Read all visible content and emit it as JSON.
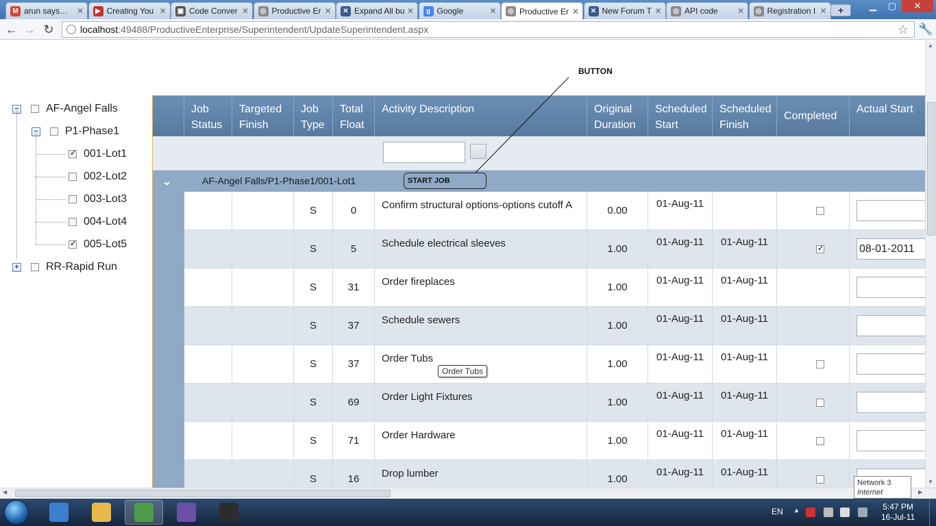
{
  "browser": {
    "tabs": [
      {
        "label": "arun says…",
        "favicon": "gmail-icon",
        "color": "#d14836",
        "glyph": "M"
      },
      {
        "label": "Creating You",
        "favicon": "youtube-icon",
        "color": "#c4302b",
        "glyph": "▶"
      },
      {
        "label": "Code Conver",
        "favicon": "page-icon",
        "color": "#555555",
        "glyph": "▣"
      },
      {
        "label": "Productive Er",
        "favicon": "globe-icon",
        "color": "#8a8a8a",
        "glyph": "◎"
      },
      {
        "label": "Expand All bu",
        "favicon": "forum-icon",
        "color": "#3a5a8c",
        "glyph": "✕"
      },
      {
        "label": "Google",
        "favicon": "google-icon",
        "color": "#4285f4",
        "glyph": "g"
      },
      {
        "label": "Productive Er",
        "favicon": "globe-icon",
        "color": "#8a8a8a",
        "glyph": "◎",
        "active": true
      },
      {
        "label": "New Forum T",
        "favicon": "forum-icon",
        "color": "#3a5a8c",
        "glyph": "✕"
      },
      {
        "label": "API code",
        "favicon": "globe-icon",
        "color": "#8a8a8a",
        "glyph": "◎"
      },
      {
        "label": "Registration I",
        "favicon": "globe-icon",
        "color": "#8a8a8a",
        "glyph": "◎"
      }
    ],
    "url_host": "localhost",
    "url_rest": ":49488/ProductiveEnterprise/Superintendent/UpdateSuperintendent.aspx"
  },
  "page": {
    "corner_text": "S",
    "tree": {
      "nodes": [
        {
          "label": "AF-Angel Falls",
          "checked": false,
          "expander": "−"
        },
        {
          "label": "P1-Phase1",
          "checked": false,
          "expander": "−"
        },
        {
          "label": "001-Lot1",
          "checked": true
        },
        {
          "label": "002-Lot2",
          "checked": false
        },
        {
          "label": "003-Lot3",
          "checked": false
        },
        {
          "label": "004-Lot4",
          "checked": false
        },
        {
          "label": "005-Lot5",
          "checked": true
        },
        {
          "label": "RR-Rapid Run",
          "checked": false,
          "expander": "+"
        }
      ]
    },
    "grid": {
      "headers": [
        {
          "label": "",
          "w": 46
        },
        {
          "label": "Job Status",
          "w": 70
        },
        {
          "label": "Targeted Finish",
          "w": 90
        },
        {
          "label": "Job Type",
          "w": 57
        },
        {
          "label": "Total Float",
          "w": 61
        },
        {
          "label": "Activity Description",
          "w": 310
        },
        {
          "label": "Original Duration",
          "w": 89
        },
        {
          "label": "Scheduled Start",
          "w": 94
        },
        {
          "label": "Scheduled Finish",
          "w": 94
        },
        {
          "label": "Completed",
          "w": 106
        },
        {
          "label": "Actual Start",
          "w": 113
        }
      ],
      "group_label": "AF-Angel Falls/P1-Phase1/001-Lot1",
      "start_job_label": "START JOB",
      "rows": [
        {
          "job_type": "S",
          "total_float": "0",
          "desc": "Confirm structural options-options cutoff A",
          "duration": "0.00",
          "sched_start": "01-Aug-11",
          "sched_finish": "",
          "completed": false,
          "show_cb": true,
          "actual_start": ""
        },
        {
          "job_type": "S",
          "total_float": "5",
          "desc": "Schedule electrical sleeves",
          "duration": "1.00",
          "sched_start": "01-Aug-11",
          "sched_finish": "01-Aug-11",
          "completed": true,
          "show_cb": true,
          "actual_start": "08-01-2011"
        },
        {
          "job_type": "S",
          "total_float": "31",
          "desc": "Order fireplaces",
          "duration": "1.00",
          "sched_start": "01-Aug-11",
          "sched_finish": "01-Aug-11",
          "completed": false,
          "show_cb": false,
          "actual_start": ""
        },
        {
          "job_type": "S",
          "total_float": "37",
          "desc": "Schedule sewers",
          "duration": "1.00",
          "sched_start": "01-Aug-11",
          "sched_finish": "01-Aug-11",
          "completed": false,
          "show_cb": false,
          "actual_start": ""
        },
        {
          "job_type": "S",
          "total_float": "37",
          "desc": "Order Tubs",
          "duration": "1.00",
          "sched_start": "01-Aug-11",
          "sched_finish": "01-Aug-11",
          "completed": false,
          "show_cb": true,
          "actual_start": ""
        },
        {
          "job_type": "S",
          "total_float": "69",
          "desc": "Order Light Fixtures",
          "duration": "1.00",
          "sched_start": "01-Aug-11",
          "sched_finish": "01-Aug-11",
          "completed": false,
          "show_cb": true,
          "actual_start": ""
        },
        {
          "job_type": "S",
          "total_float": "71",
          "desc": "Order Hardware",
          "duration": "1.00",
          "sched_start": "01-Aug-11",
          "sched_finish": "01-Aug-11",
          "completed": false,
          "show_cb": true,
          "actual_start": ""
        },
        {
          "job_type": "S",
          "total_float": "16",
          "desc": "Drop lumber",
          "duration": "1.00",
          "sched_start": "01-Aug-11",
          "sched_finish": "01-Aug-11",
          "completed": false,
          "show_cb": true,
          "actual_start": ""
        }
      ]
    },
    "annotation_label": "BUTTON",
    "tooltip": "Order Tubs"
  },
  "network_tip": {
    "title": "Network 3",
    "sub": "Internet access"
  },
  "taskbar": {
    "lang": "EN",
    "time": "5:47 PM",
    "date": "16-Jul-11",
    "apps": [
      {
        "name": "media-player-icon",
        "color": "#3c7fd1"
      },
      {
        "name": "explorer-icon",
        "color": "#e8b84a"
      },
      {
        "name": "chrome-icon",
        "color": "#4c9c4a",
        "active": true
      },
      {
        "name": "visual-studio-icon",
        "color": "#6a4ea8"
      },
      {
        "name": "gtalk-icon",
        "color": "#2c2c2c"
      }
    ]
  }
}
